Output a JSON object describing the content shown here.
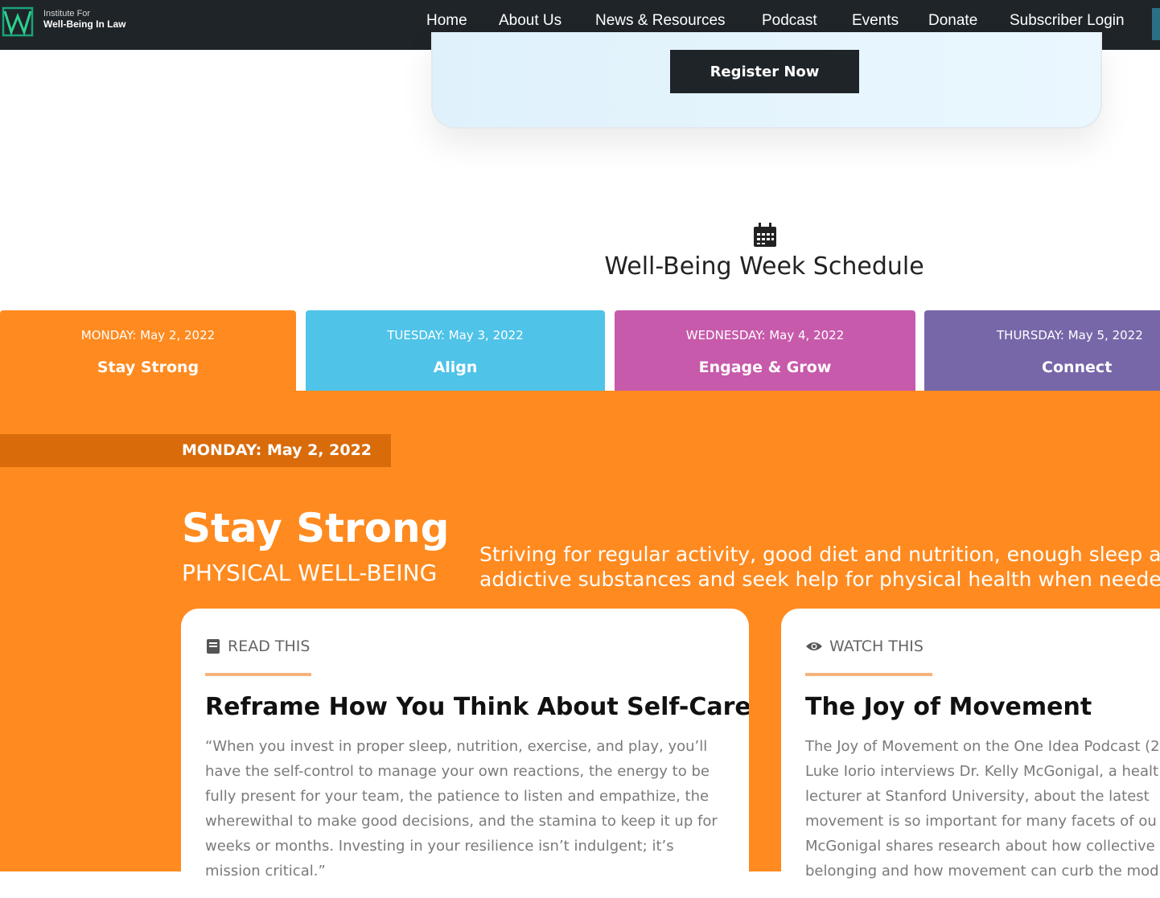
{
  "nav": {
    "brand_line1": "Institute For",
    "brand_line2": "Well-Being In Law",
    "items": [
      "Home",
      "About Us",
      "News & Resources",
      "Podcast",
      "Events",
      "Donate",
      "Subscriber Login"
    ]
  },
  "register": {
    "button_label": "Register Now"
  },
  "schedule": {
    "title": "Well-Being Week Schedule",
    "icon": "calendar-icon"
  },
  "tabs": [
    {
      "date": "MONDAY: May 2, 2022",
      "name": "Stay Strong",
      "color": "#ff8a1f"
    },
    {
      "date": "TUESDAY: May 3, 2022",
      "name": "Align",
      "color": "#4fc3e8"
    },
    {
      "date": "WEDNESDAY: May 4, 2022",
      "name": "Engage & Grow",
      "color": "#c75aab"
    },
    {
      "date": "THURSDAY: May 5, 2022",
      "name": "Connect",
      "color": "#7767a8"
    }
  ],
  "day": {
    "strip": "MONDAY: May 2, 2022",
    "title": "Stay Strong",
    "subtitle": "PHYSICAL WELL-BEING",
    "desc_line1": "Striving for regular activity, good diet and nutrition, enough sleep and",
    "desc_line2": "addictive substances and seek help for physical health when needed."
  },
  "cards": [
    {
      "label": "READ THIS",
      "icon": "book-icon",
      "title": "Reframe How You Think About Self-Care",
      "lines": [
        "“When you invest in proper sleep, nutrition, exercise, and play, you’ll",
        "have the self-control to manage your own reactions, the energy to be",
        "fully present for your team, the patience to listen and empathize, the",
        "wherewithal to make good decisions, and the stamina to keep it up for",
        "weeks or months. Investing in your resilience isn’t indulgent; it’s",
        "mission critical.”"
      ]
    },
    {
      "label": "WATCH THIS",
      "icon": "eye-icon",
      "title": "The Joy of Movement",
      "lines": [
        "The Joy of Movement on the One Idea Podcast (2",
        "Luke Iorio interviews Dr. Kelly McGonigal, a healt",
        "lecturer at Stanford University, about  the latest",
        "movement is so important for many facets of ou",
        "McGonigal shares research about how collective",
        "belonging and how movement can curb the mod"
      ]
    }
  ]
}
